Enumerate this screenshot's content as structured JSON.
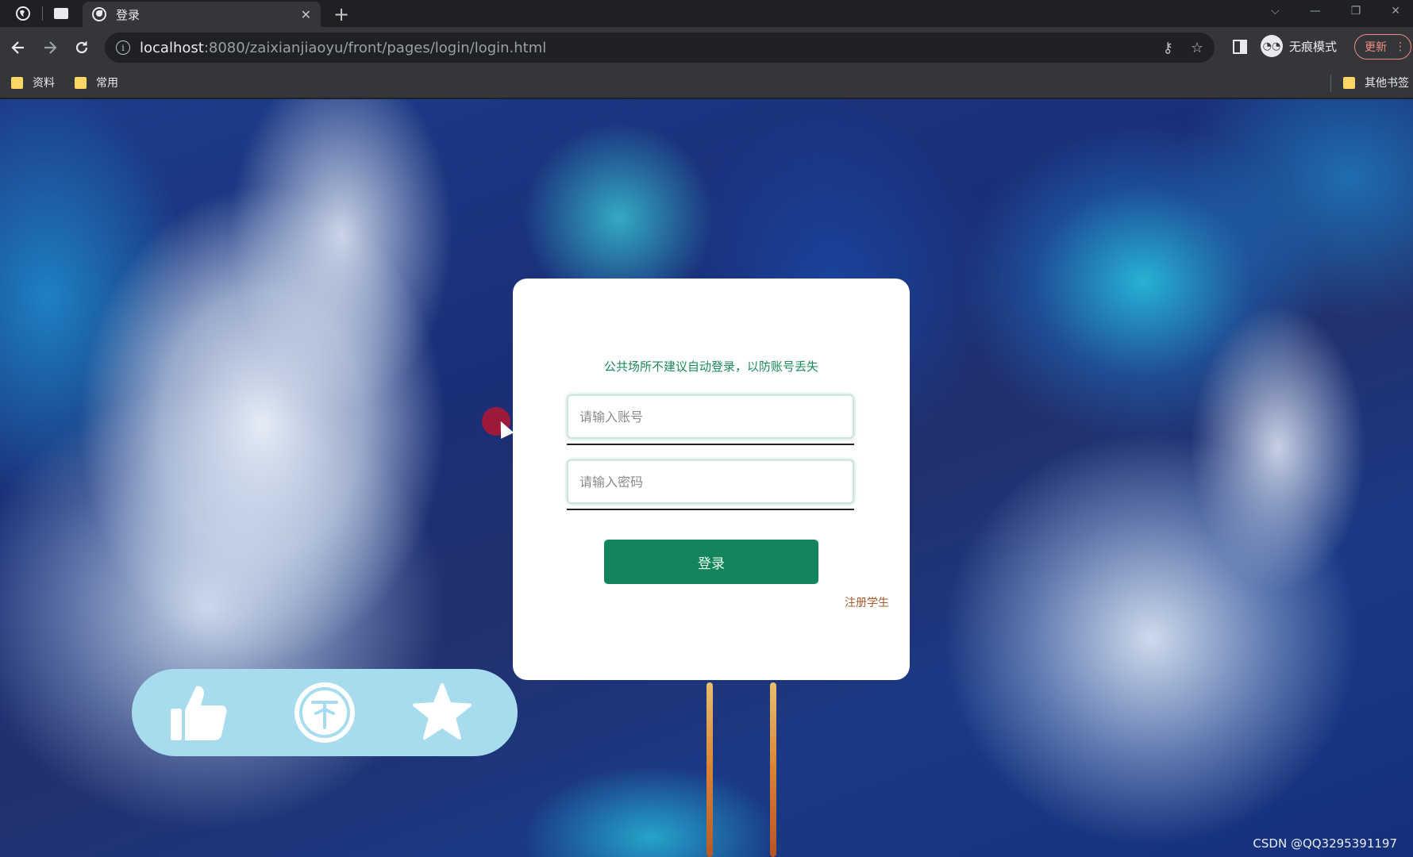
{
  "browser": {
    "tab_title": "登录",
    "url_host": "localhost",
    "url_rest": ":8080/zaixianjiaoyu/front/pages/login/login.html",
    "incognito_label": "无痕模式",
    "update_label": "更新",
    "bookmarks": [
      {
        "label": "资料",
        "icon": "folder-icon"
      },
      {
        "label": "常用",
        "icon": "folder-icon"
      }
    ],
    "other_bookmarks_label": "其他书签"
  },
  "login": {
    "tip": "公共场所不建议自动登录，以防账号丢失",
    "account_placeholder": "请输入账号",
    "password_placeholder": "请输入密码",
    "submit_label": "登录",
    "register_label": "注册学生"
  },
  "actions": [
    {
      "name": "like",
      "icon": "thumbs-up-icon"
    },
    {
      "name": "coin",
      "icon": "coin-icon"
    },
    {
      "name": "favorite",
      "icon": "star-icon"
    }
  ],
  "colors": {
    "primary": "#13845c",
    "tip_text": "#1b8a5a",
    "register_link": "#a8582a",
    "action_bar": "#a6dcee"
  },
  "watermark": "CSDN @QQ3295391197"
}
